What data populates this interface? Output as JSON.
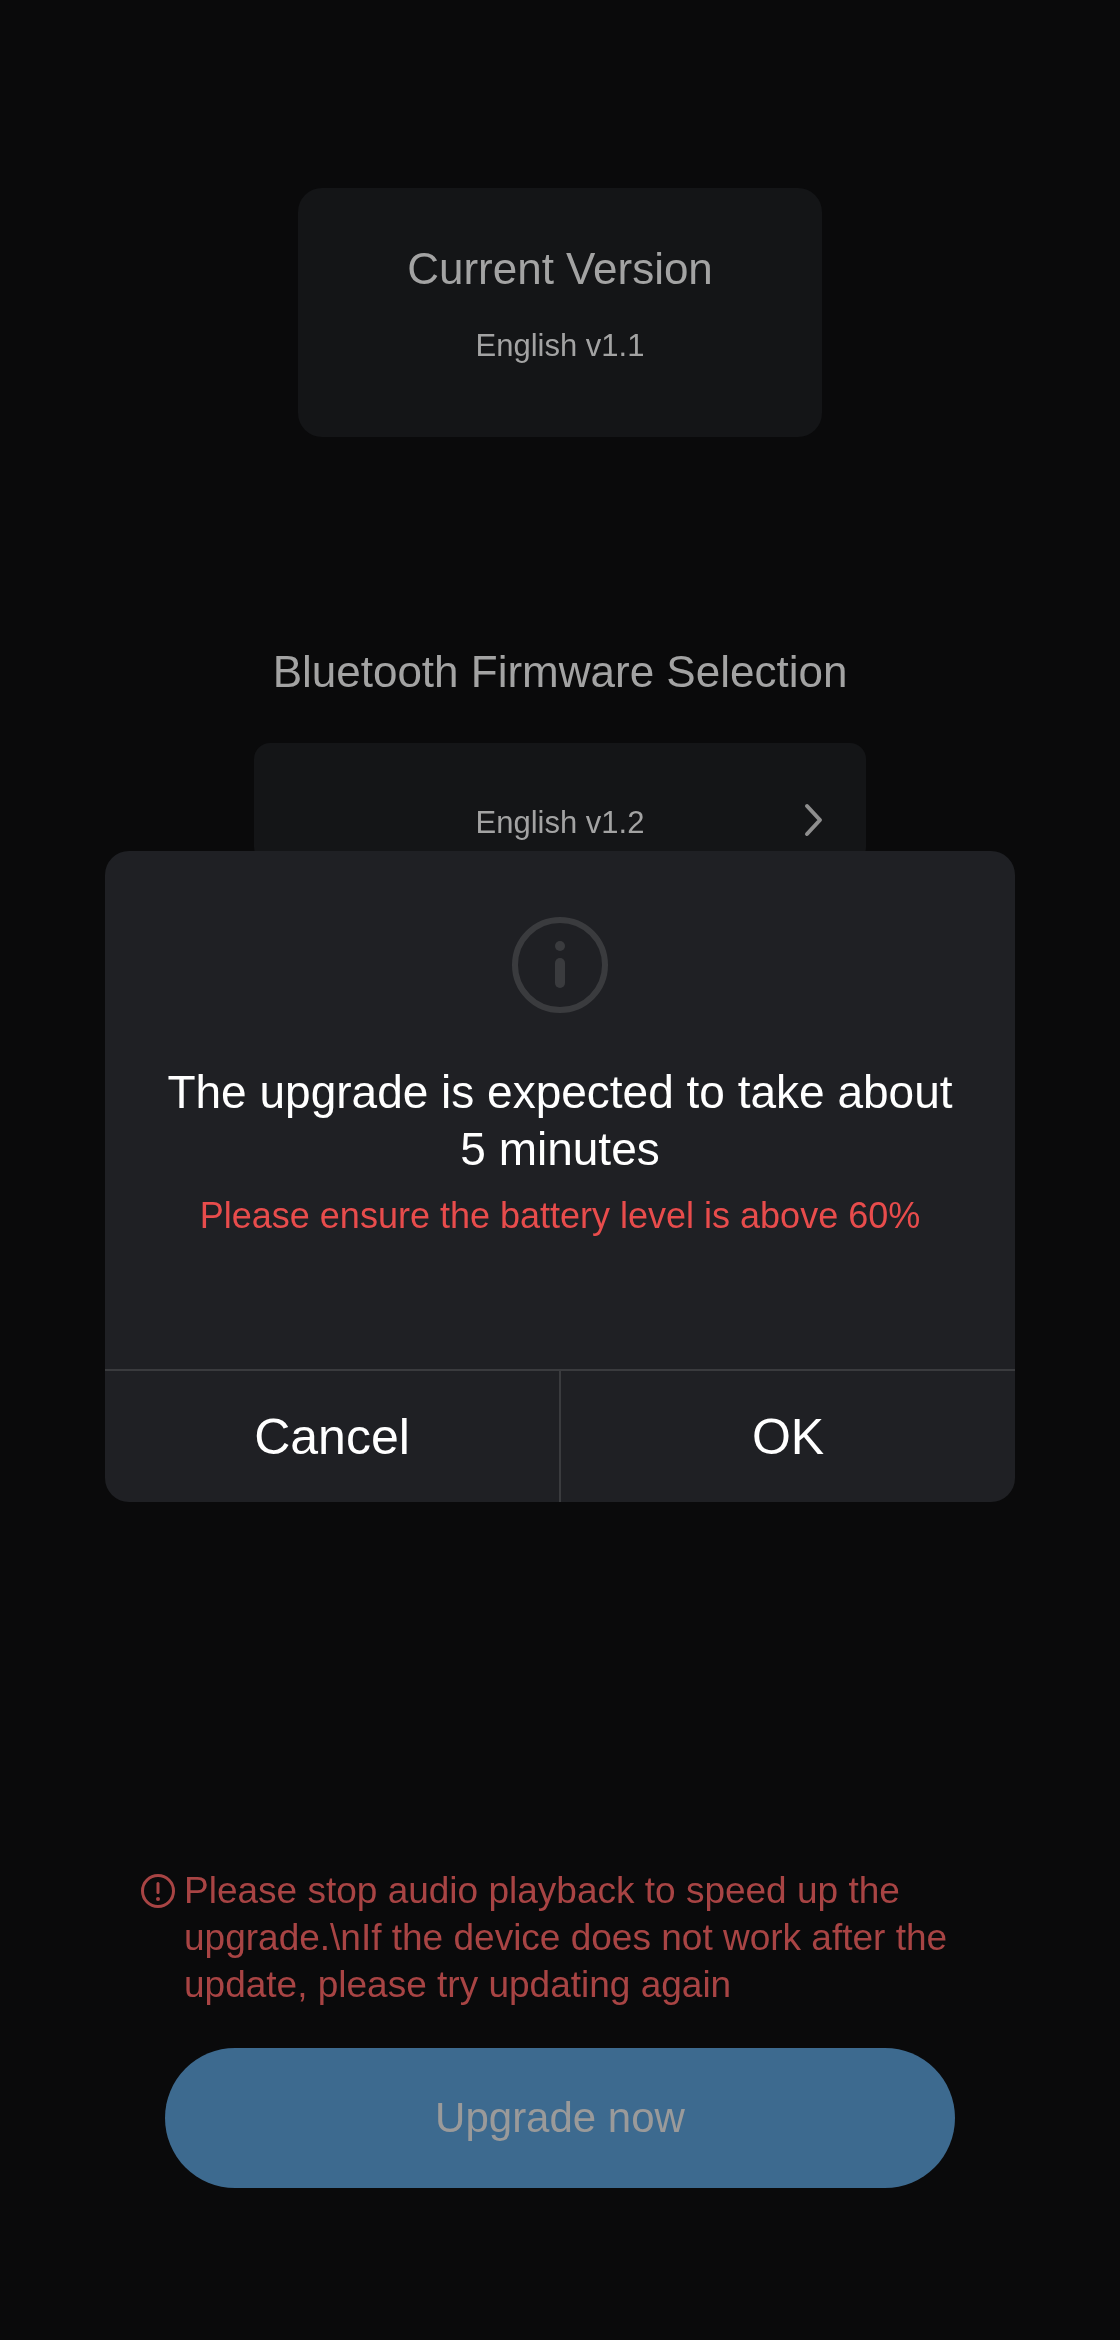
{
  "current_version": {
    "title": "Current Version",
    "value": "English v1.1"
  },
  "firmware_selection": {
    "title": "Bluetooth Firmware Selection",
    "option": "English v1.2"
  },
  "dialog": {
    "message": "The upgrade is expected to take about 5 minutes",
    "warning": "Please ensure the battery level is above 60%",
    "buttons": [
      "Cancel",
      "OK"
    ]
  },
  "notice": {
    "text": "Please stop audio playback to speed up the upgrade.\\nIf the device does not work after the update, please try updating again"
  },
  "upgrade_button": {
    "label": "Upgrade now",
    "disabled": true
  }
}
